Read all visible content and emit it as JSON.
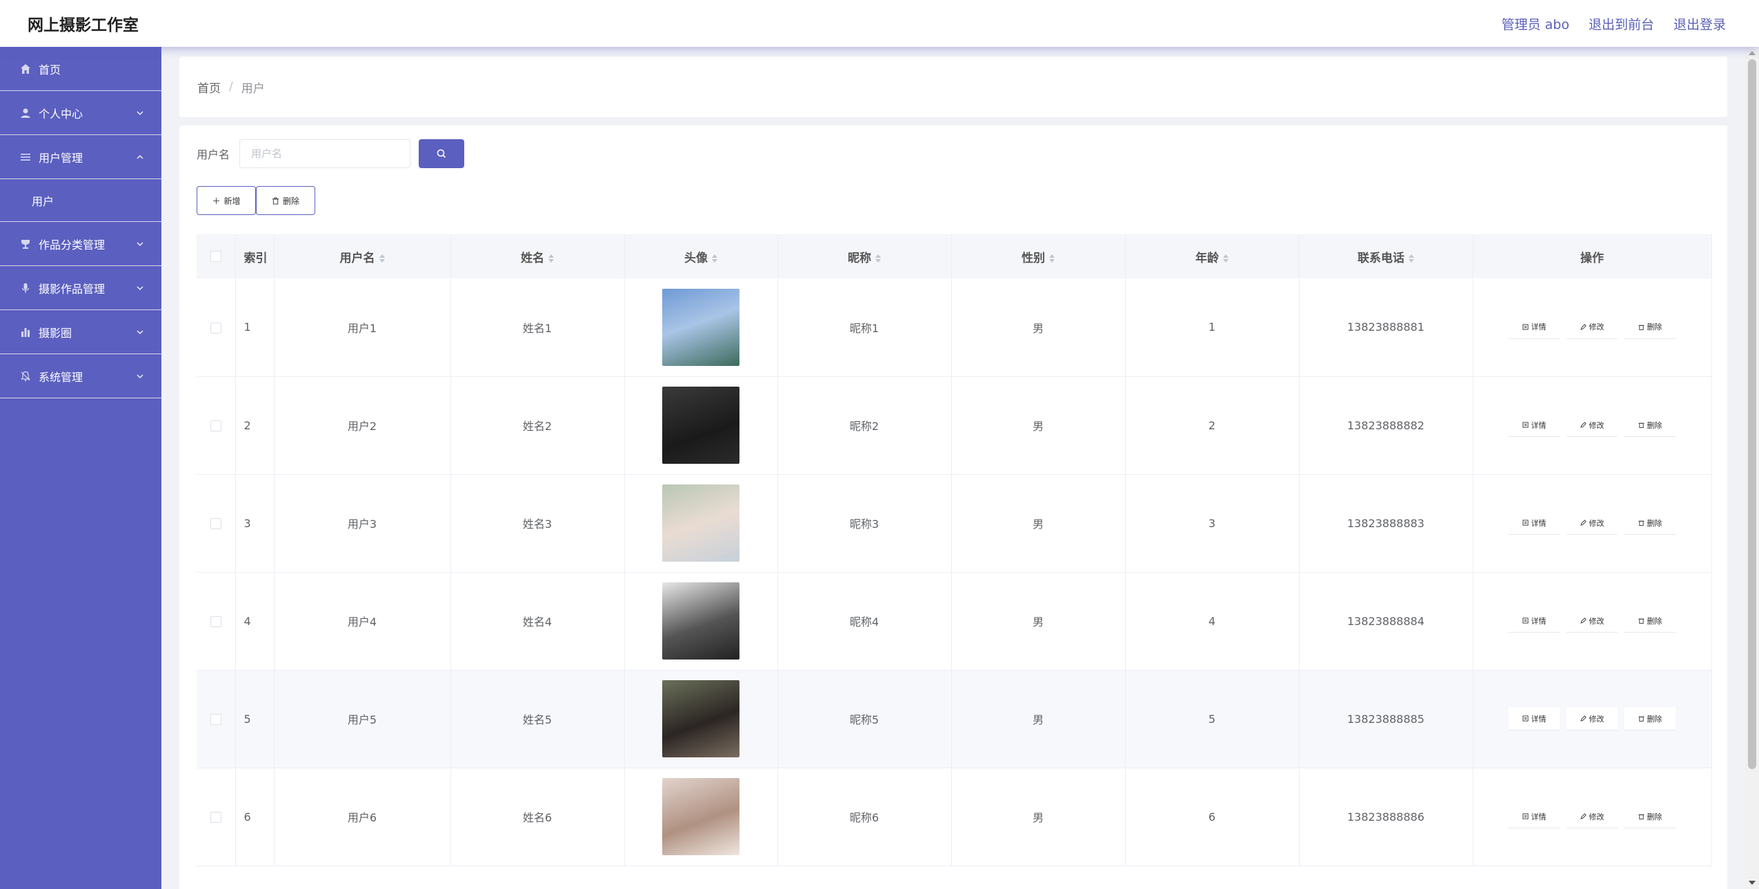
{
  "header": {
    "title": "网上摄影工作室",
    "admin_label": "管理员 abo",
    "to_front": "退出到前台",
    "logout": "退出登录"
  },
  "sidebar": {
    "items": [
      {
        "label": "首页",
        "icon": "home-icon"
      },
      {
        "label": "个人中心",
        "icon": "user-icon"
      },
      {
        "label": "用户管理",
        "icon": "menu-icon",
        "expanded": true
      },
      {
        "label": "作品分类管理",
        "icon": "trophy-icon"
      },
      {
        "label": "摄影作品管理",
        "icon": "microphone-icon"
      },
      {
        "label": "摄影圈",
        "icon": "bar-chart-icon"
      },
      {
        "label": "系统管理",
        "icon": "bell-icon"
      }
    ],
    "sub_item": "用户"
  },
  "breadcrumb": {
    "home": "首页",
    "sep": "/",
    "current": "用户"
  },
  "search": {
    "label": "用户名",
    "placeholder": "用户名"
  },
  "actions": {
    "add": "新增",
    "delete": "删除"
  },
  "table": {
    "columns": [
      "索引",
      "用户名",
      "姓名",
      "头像",
      "昵称",
      "性别",
      "年龄",
      "联系电话",
      "操作"
    ],
    "row_actions": {
      "detail": "详情",
      "edit": "修改",
      "delete": "删除"
    },
    "rows": [
      {
        "index": "1",
        "username": "用户1",
        "name": "姓名1",
        "nickname": "昵称1",
        "gender": "男",
        "age": "1",
        "phone": "13823888881"
      },
      {
        "index": "2",
        "username": "用户2",
        "name": "姓名2",
        "nickname": "昵称2",
        "gender": "男",
        "age": "2",
        "phone": "13823888882"
      },
      {
        "index": "3",
        "username": "用户3",
        "name": "姓名3",
        "nickname": "昵称3",
        "gender": "男",
        "age": "3",
        "phone": "13823888883"
      },
      {
        "index": "4",
        "username": "用户4",
        "name": "姓名4",
        "nickname": "昵称4",
        "gender": "男",
        "age": "4",
        "phone": "13823888884"
      },
      {
        "index": "5",
        "username": "用户5",
        "name": "姓名5",
        "nickname": "昵称5",
        "gender": "男",
        "age": "5",
        "phone": "13823888885"
      },
      {
        "index": "6",
        "username": "用户6",
        "name": "姓名6",
        "nickname": "昵称6",
        "gender": "男",
        "age": "6",
        "phone": "13823888886"
      }
    ]
  },
  "colors": {
    "accent": "#5b5fbf",
    "header_bg": "#ffffff",
    "page_bg": "#f1f2f6"
  }
}
